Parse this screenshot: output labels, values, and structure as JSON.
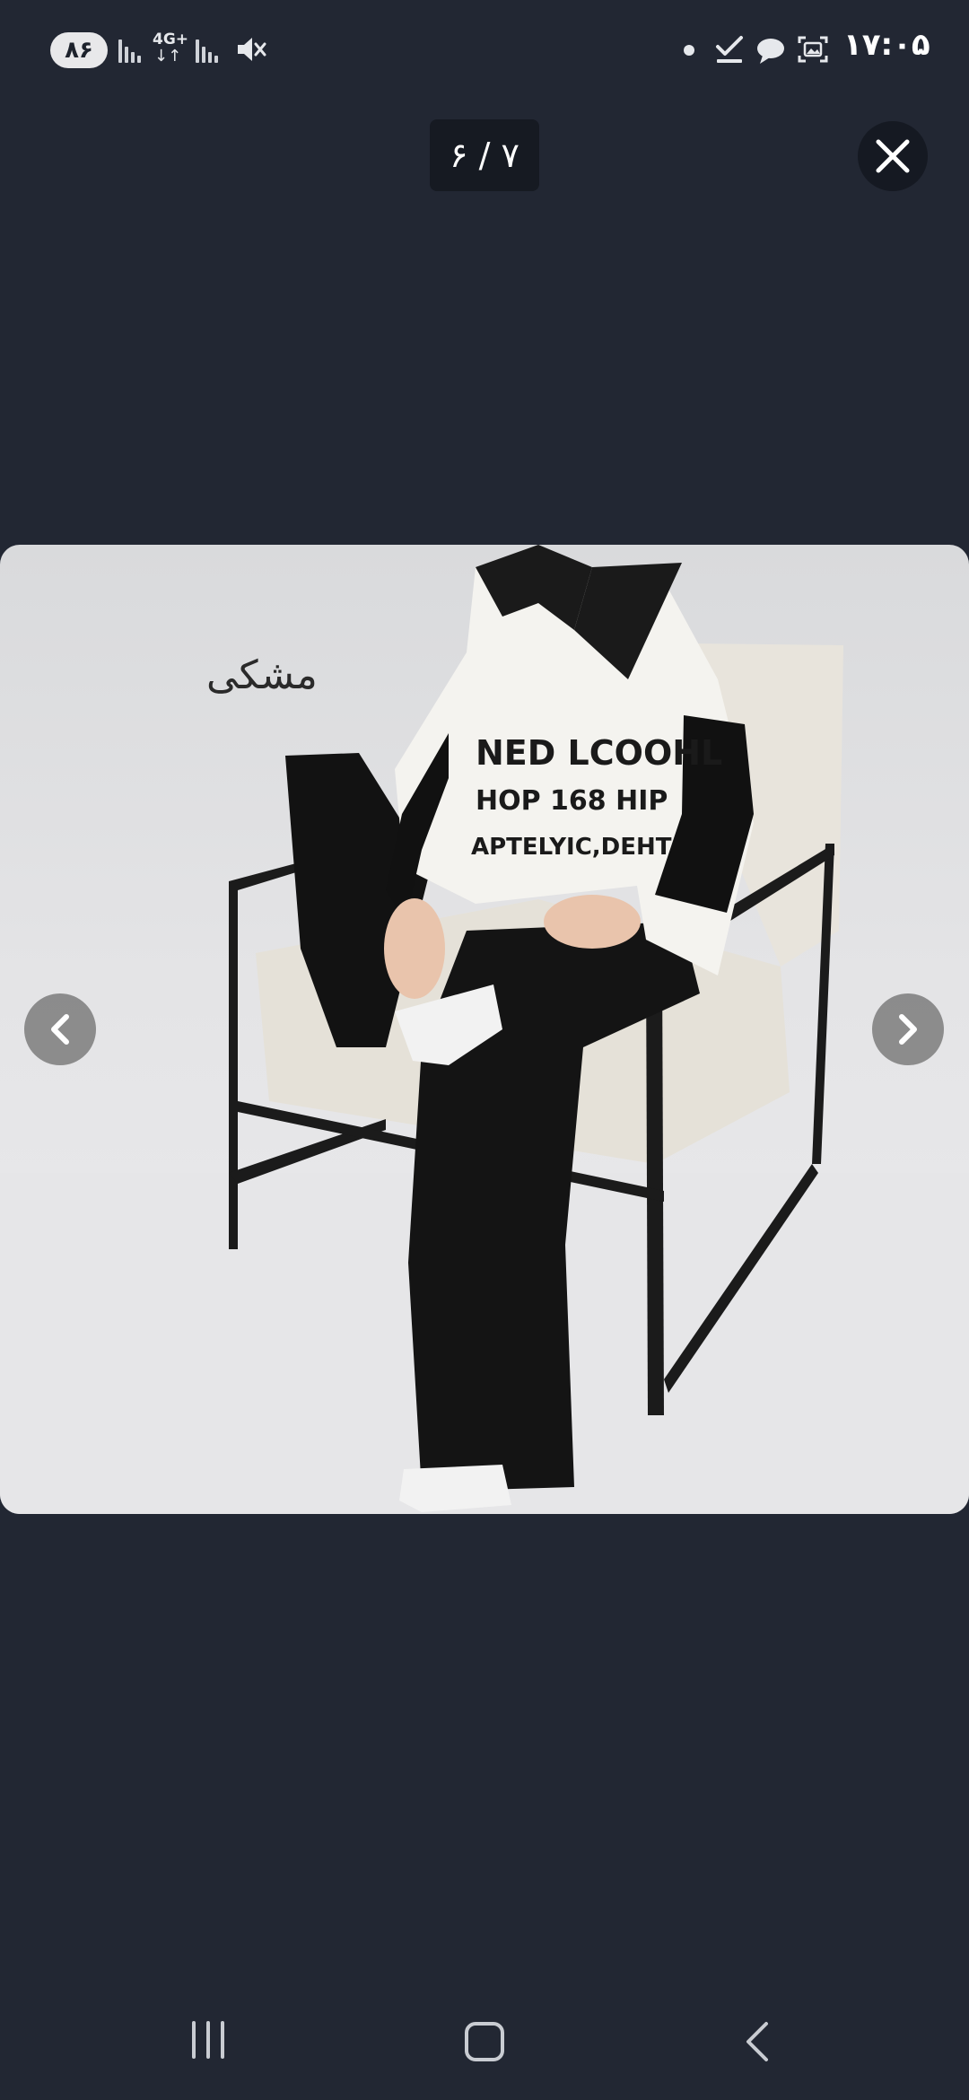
{
  "status_bar": {
    "battery": "۸۶",
    "network_type": "4G+",
    "time": "۱۷:۰۵"
  },
  "viewer": {
    "counter": "۶ / ۷",
    "caption": "مشکی"
  },
  "icons": {
    "close": "close-icon",
    "prev": "chevron-left-icon",
    "next": "chevron-right-icon"
  },
  "colors": {
    "background": "#222733",
    "counter_bg": "#161a22",
    "nav_arrow_bg": "#6e6e6e"
  }
}
